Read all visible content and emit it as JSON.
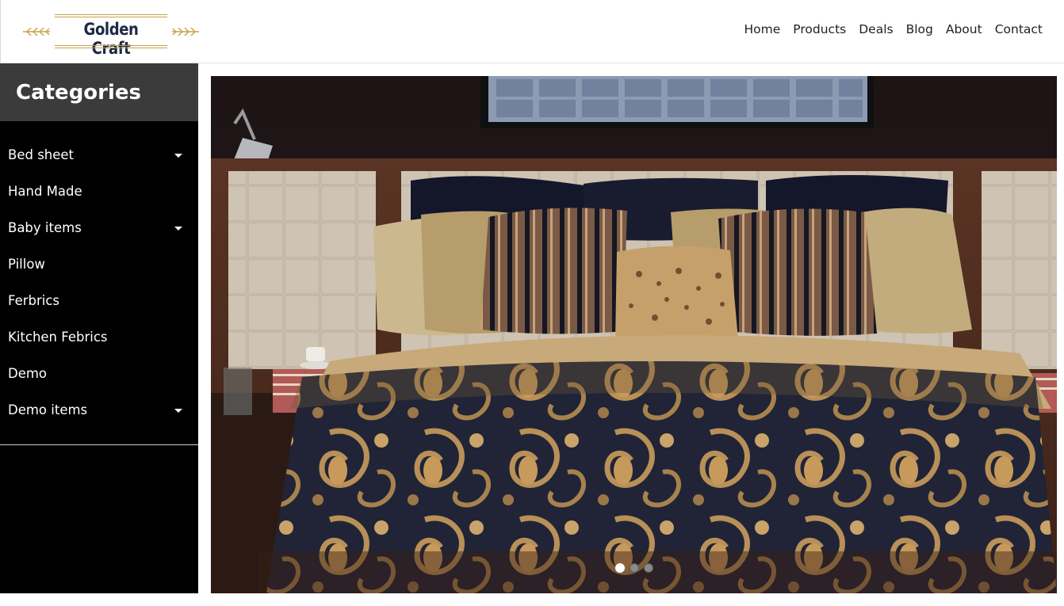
{
  "brand": {
    "name": "Golden Craft"
  },
  "nav": [
    {
      "label": "Home"
    },
    {
      "label": "Products"
    },
    {
      "label": "Deals"
    },
    {
      "label": "Blog"
    },
    {
      "label": "About"
    },
    {
      "label": "Contact"
    }
  ],
  "sidebar": {
    "title": "Categories",
    "items": [
      {
        "label": "Bed sheet",
        "has_dropdown": true
      },
      {
        "label": "Hand Made",
        "has_dropdown": false
      },
      {
        "label": "Baby items",
        "has_dropdown": true
      },
      {
        "label": "Pillow",
        "has_dropdown": false
      },
      {
        "label": "Ferbrics",
        "has_dropdown": false
      },
      {
        "label": "Kitchen Febrics",
        "has_dropdown": false
      },
      {
        "label": "Demo",
        "has_dropdown": false
      },
      {
        "label": "Demo items",
        "has_dropdown": true
      }
    ]
  },
  "slider": {
    "slide_count": 3,
    "active_index": 0,
    "image": "bedroom-paisley-bedding"
  },
  "colors": {
    "sidebar_bg": "#000000",
    "sidebar_header_bg": "#3b3b3b",
    "brand_text": "#1b2a44",
    "brand_gold": "#c9a24a"
  }
}
